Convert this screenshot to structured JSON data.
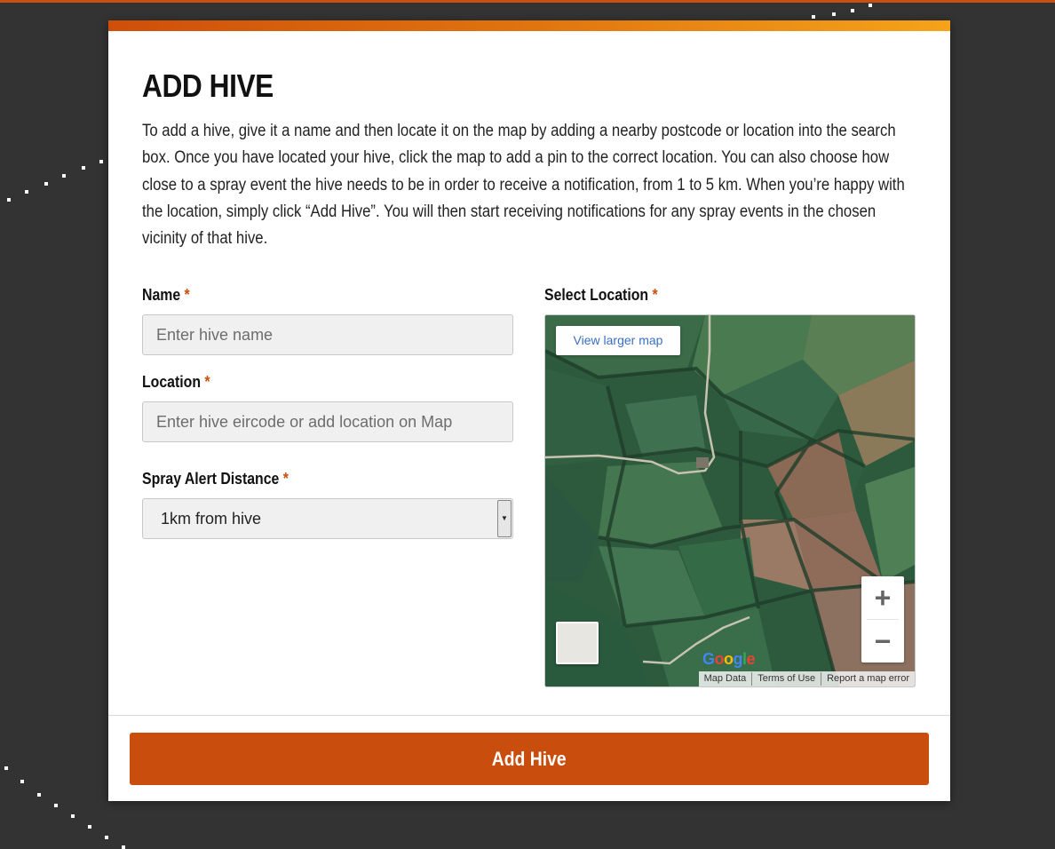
{
  "modal": {
    "title": "ADD HIVE",
    "description": "To add a hive, give it a name and then locate it on the map by adding a nearby postcode or location into the search box. Once you have located your hive, click the map to add a pin to the correct location. You can also choose how close to a spray event the hive needs to be in order to receive a notification, from 1 to 5 km. When you’re happy with the location, simply click “Add Hive”. You will then start receiving notifications for any spray events in the chosen vicinity of that hive."
  },
  "form": {
    "required_marker": "*",
    "name": {
      "label": "Name",
      "placeholder": "Enter hive name",
      "value": ""
    },
    "location": {
      "label": "Location",
      "placeholder": "Enter hive eircode or add location on Map",
      "value": ""
    },
    "spray_alert": {
      "label": "Spray Alert Distance",
      "selected": "1km from hive"
    }
  },
  "map": {
    "label": "Select Location",
    "view_larger": "View larger map",
    "zoom_in": "+",
    "zoom_out": "−",
    "logo": "Google",
    "attribution": [
      "Map Data",
      "Terms of Use",
      "Report a map error"
    ],
    "map_type": "satellite"
  },
  "actions": {
    "submit_label": "Add Hive"
  },
  "colors": {
    "accent": "#c94d0c",
    "background": "#333333",
    "link": "#3a6fc4"
  }
}
